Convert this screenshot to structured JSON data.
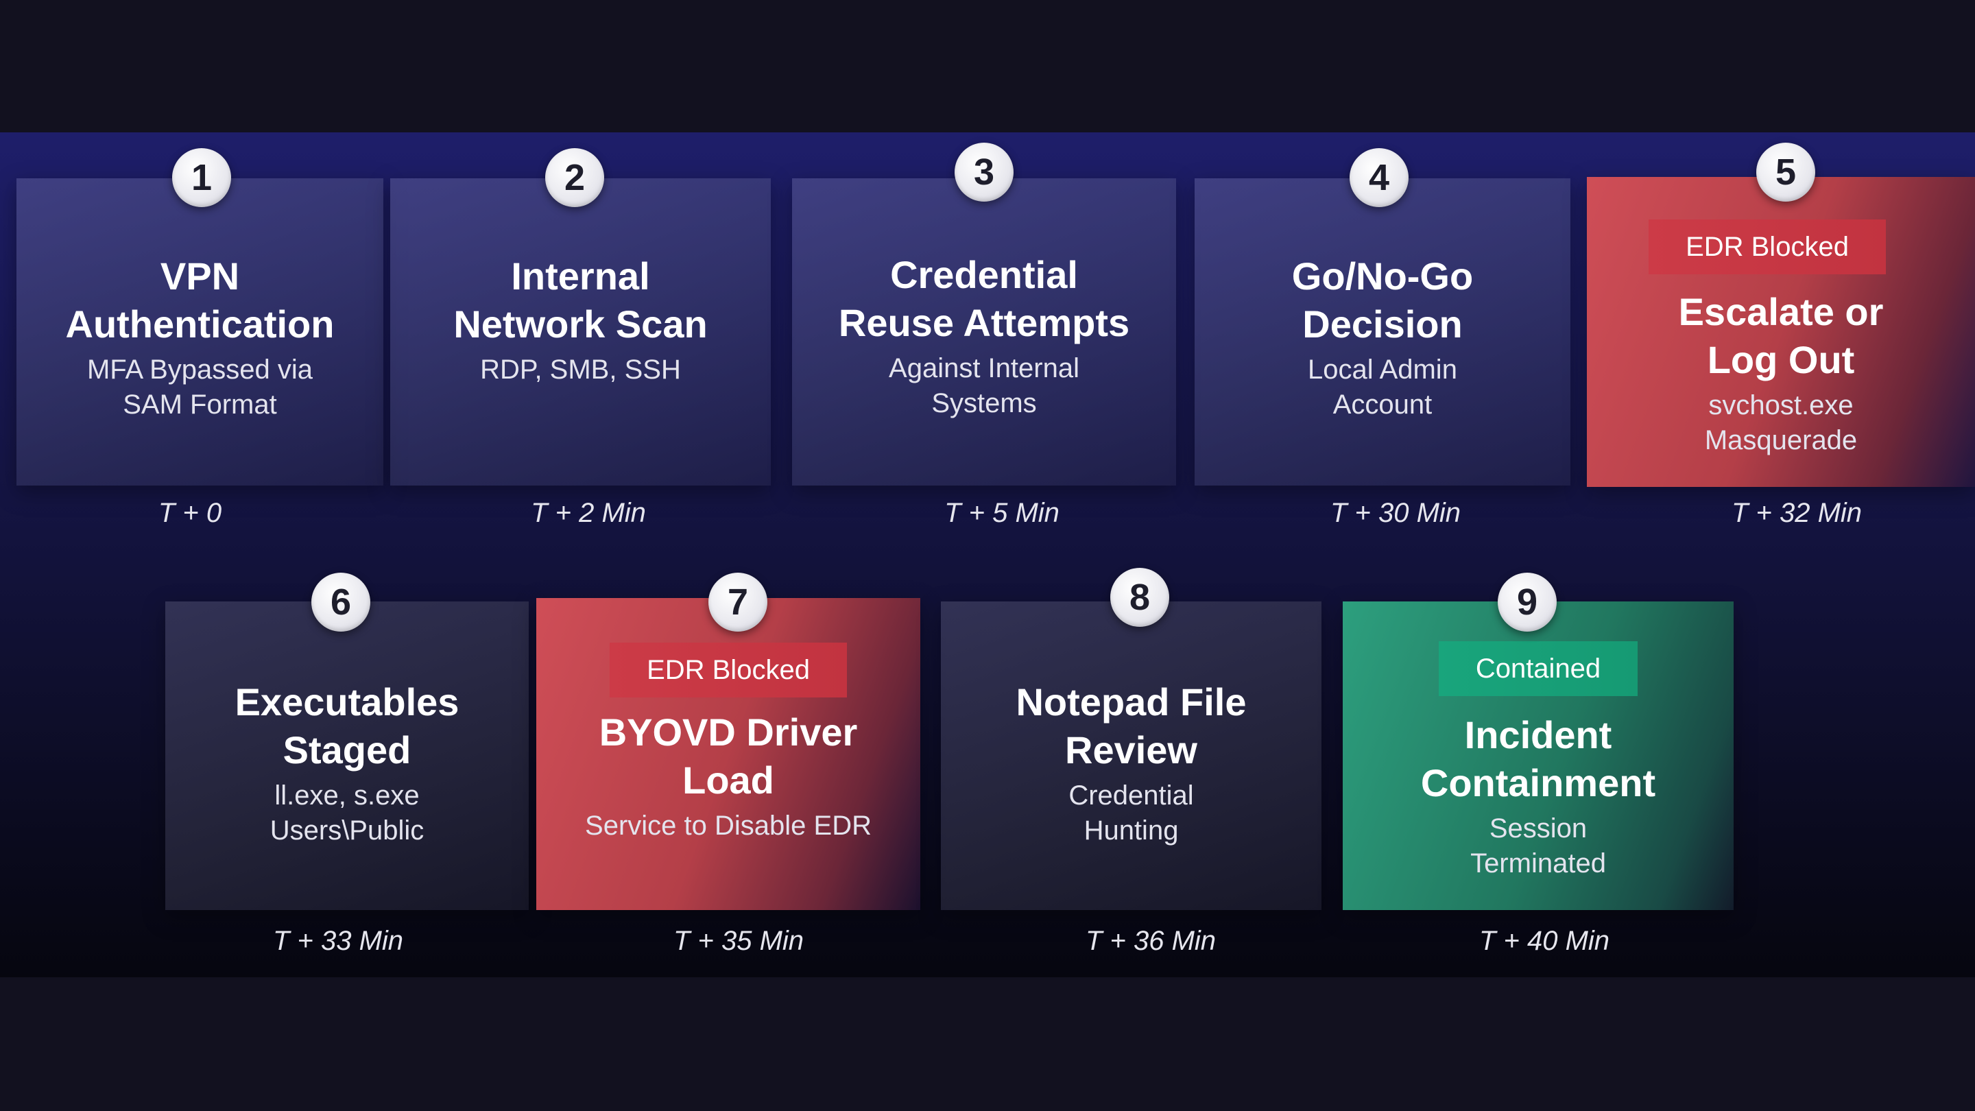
{
  "steps": [
    {
      "num": "1",
      "title_l1": "VPN",
      "title_l2": "Authentication",
      "sub_l1": "MFA Bypassed via",
      "sub_l2": "SAM Format",
      "time": "T + 0"
    },
    {
      "num": "2",
      "title_l1": "Internal",
      "title_l2": "Network Scan",
      "sub_l1": "RDP, SMB, SSH",
      "sub_l2": "",
      "time": "T + 2 Min"
    },
    {
      "num": "3",
      "title_l1": "Credential",
      "title_l2": "Reuse Attempts",
      "sub_l1": "Against Internal",
      "sub_l2": "Systems",
      "time": "T + 5 Min"
    },
    {
      "num": "4",
      "title_l1": "Go/No-Go",
      "title_l2": "Decision",
      "sub_l1": "Local Admin",
      "sub_l2": "Account",
      "time": "T + 30 Min"
    },
    {
      "num": "5",
      "tag": "EDR Blocked",
      "title_l1": "Escalate or",
      "title_l2": "Log Out",
      "sub_l1": "svchost.exe",
      "sub_l2": "Masquerade",
      "time": "T + 32 Min"
    },
    {
      "num": "6",
      "title_l1": "Executables",
      "title_l2": "Staged",
      "sub_l1": "ll.exe, s.exe",
      "sub_l2": "Users\\Public",
      "time": "T + 33 Min"
    },
    {
      "num": "7",
      "tag": "EDR Blocked",
      "title_l1": "BYOVD Driver",
      "title_l2": "Load",
      "sub_l1": "Service to Disable EDR",
      "sub_l2": "",
      "time": "T + 35 Min"
    },
    {
      "num": "8",
      "title_l1": "Notepad File",
      "title_l2": "Review",
      "sub_l1": "Credential",
      "sub_l2": "Hunting",
      "time": "T + 36 Min"
    },
    {
      "num": "9",
      "tag": "Contained",
      "title_l1": "Incident",
      "title_l2": "Containment",
      "sub_l1": "Session",
      "sub_l2": "Terminated",
      "time": "T + 40 Min"
    }
  ],
  "colors": {
    "background": "#12111f",
    "blocked": "#c23340",
    "contained": "#169a73",
    "neutral_card": "#4a4a80"
  }
}
